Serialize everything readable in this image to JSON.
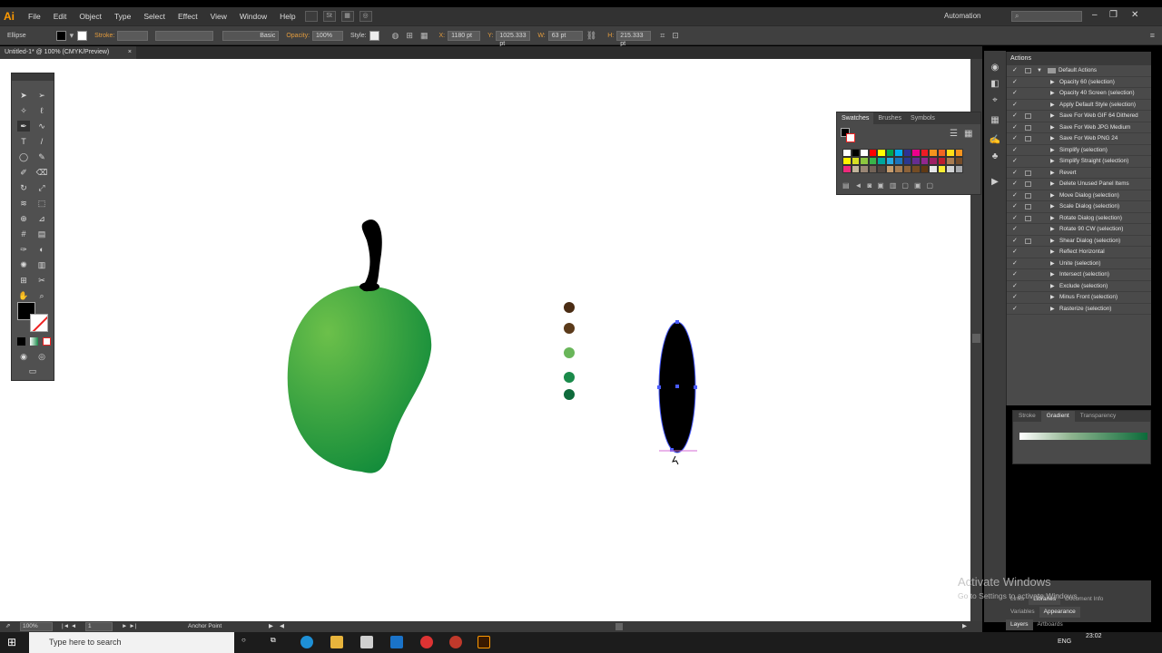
{
  "menubar": {
    "logo": "Ai",
    "items": [
      "File",
      "Edit",
      "Object",
      "Type",
      "Select",
      "Effect",
      "View",
      "Window",
      "Help"
    ],
    "workspace": "Automation",
    "search_placeholder": "",
    "window_controls": [
      "–",
      "❐",
      "✕"
    ]
  },
  "controlbar": {
    "object_type": "Ellipse",
    "stroke_label": "Stroke:",
    "brush_label": "Basic",
    "opacity_label": "Opacity:",
    "opacity_value": "100%",
    "style_label": "Style:",
    "x_label": "X:",
    "x_value": "1180 pt",
    "y_label": "Y:",
    "y_value": "1025.333 pt",
    "w_label": "W:",
    "w_value": "63 pt",
    "h_label": "H:",
    "h_value": "215.333 pt"
  },
  "document": {
    "tab_title": "Untitled-1* @ 100% (CMYK/Preview)",
    "tab_close": "×"
  },
  "canvas": {
    "dot_colors": [
      "#4a2c14",
      "#5b3a1a",
      "#69b65a",
      "#1a8a4a",
      "#0f6b3c"
    ],
    "mango_light": "#6cc04a",
    "mango_dark": "#0f8a3a",
    "ellipse_fill": "#000000",
    "selection_color": "#4a5cff"
  },
  "swatches": {
    "tabs": [
      "Swatches",
      "Brushes",
      "Symbols"
    ],
    "colors": [
      "#ffffff",
      "#000000",
      "#ffffff",
      "#ff0000",
      "#ffff00",
      "#00a651",
      "#00aeef",
      "#2e3192",
      "#ec008c",
      "#ed1c24",
      "#f7941d",
      "#f26522",
      "#ffde17",
      "#f7941d",
      "#fff200",
      "#d7df23",
      "#8dc63f",
      "#39b54a",
      "#00a79d",
      "#27aae1",
      "#1c75bc",
      "#2b388f",
      "#662d91",
      "#92278f",
      "#9e1f63",
      "#be1e2d",
      "#a97c50",
      "#754c29",
      "#ee2a7b",
      "#c2b59b",
      "#998675",
      "#736357",
      "#534741",
      "#c69c6d",
      "#a67c52",
      "#8c6239",
      "#754c24",
      "#603913",
      "#e6e7e8",
      "#f9ed32",
      "#d1d3d4",
      "#a7a9ac"
    ]
  },
  "actions": {
    "title": "Actions",
    "set_name": "Default Actions",
    "items": [
      {
        "label": "Opacity 60 (selection)",
        "dialog": false
      },
      {
        "label": "Opacity 40 Screen (selection)",
        "dialog": false
      },
      {
        "label": "Apply Default Style (selection)",
        "dialog": false
      },
      {
        "label": "Save For Web GIF 64 Dithered",
        "dialog": true
      },
      {
        "label": "Save For Web JPG Medium",
        "dialog": true
      },
      {
        "label": "Save For Web PNG 24",
        "dialog": true
      },
      {
        "label": "Simplify (selection)",
        "dialog": false
      },
      {
        "label": "Simplify Straight (selection)",
        "dialog": false
      },
      {
        "label": "Revert",
        "dialog": true
      },
      {
        "label": "Delete Unused Panel Items",
        "dialog": true
      },
      {
        "label": "Move Dialog (selection)",
        "dialog": true
      },
      {
        "label": "Scale Dialog (selection)",
        "dialog": true
      },
      {
        "label": "Rotate Dialog (selection)",
        "dialog": true
      },
      {
        "label": "Rotate 90 CW (selection)",
        "dialog": false
      },
      {
        "label": "Shear Dialog (selection)",
        "dialog": true
      },
      {
        "label": "Reflect Horizontal",
        "dialog": false
      },
      {
        "label": "Unite (selection)",
        "dialog": false
      },
      {
        "label": "Intersect (selection)",
        "dialog": false
      },
      {
        "label": "Exclude (selection)",
        "dialog": false
      },
      {
        "label": "Minus Front (selection)",
        "dialog": false
      },
      {
        "label": "Rasterize (selection)",
        "dialog": false
      }
    ]
  },
  "gradient_panel": {
    "tabs": [
      "Stroke",
      "Gradient",
      "Transparency"
    ],
    "active": "Gradient"
  },
  "bottom_panels": {
    "row1": [
      "Links",
      "Libraries",
      "Document Info"
    ],
    "row2": [
      "Variables",
      "Appearance"
    ],
    "row3": [
      "Layers",
      "Artboards"
    ]
  },
  "statusbar": {
    "zoom": "100%",
    "page": "1",
    "tool_name": "Anchor Point"
  },
  "taskbar": {
    "search_placeholder": "Type here to search",
    "lang": "ENG",
    "time": "23:02"
  },
  "watermark": {
    "line1": "Activate Windows",
    "line2": "Go to Settings to activate Windows."
  }
}
